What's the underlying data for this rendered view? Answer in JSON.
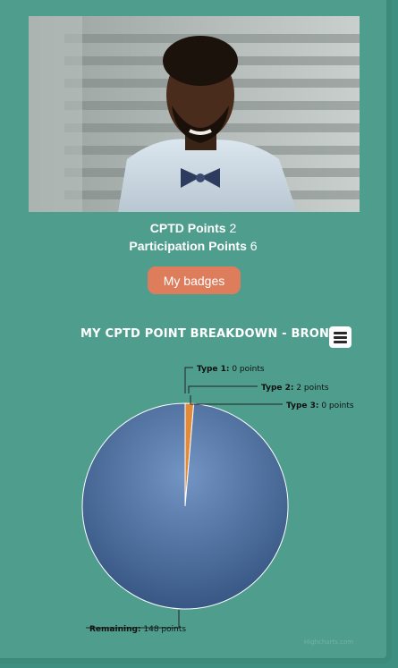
{
  "profile": {
    "cptd_label": "CPTD Points",
    "cptd_value": "2",
    "participation_label": "Participation Points",
    "participation_value": "6",
    "badges_button": "My badges"
  },
  "menu_icon": "hamburger-menu-icon",
  "colors": {
    "background": "#4f9e8d",
    "button": "#de7d5c",
    "pie_remaining": "#4f6fa0",
    "pie_slice": "#e08a3a"
  },
  "chart_data": {
    "type": "pie",
    "title": "MY CPTD POINT BREAKDOWN - BRONZE",
    "slices": [
      {
        "name": "Type 1",
        "value": 0,
        "label": "0 points"
      },
      {
        "name": "Type 2",
        "value": 2,
        "label": "2 points"
      },
      {
        "name": "Type 3",
        "value": 0,
        "label": "0 points"
      },
      {
        "name": "Remaining",
        "value": 148,
        "label": "148 points"
      }
    ],
    "credit": "Highcharts.com"
  }
}
